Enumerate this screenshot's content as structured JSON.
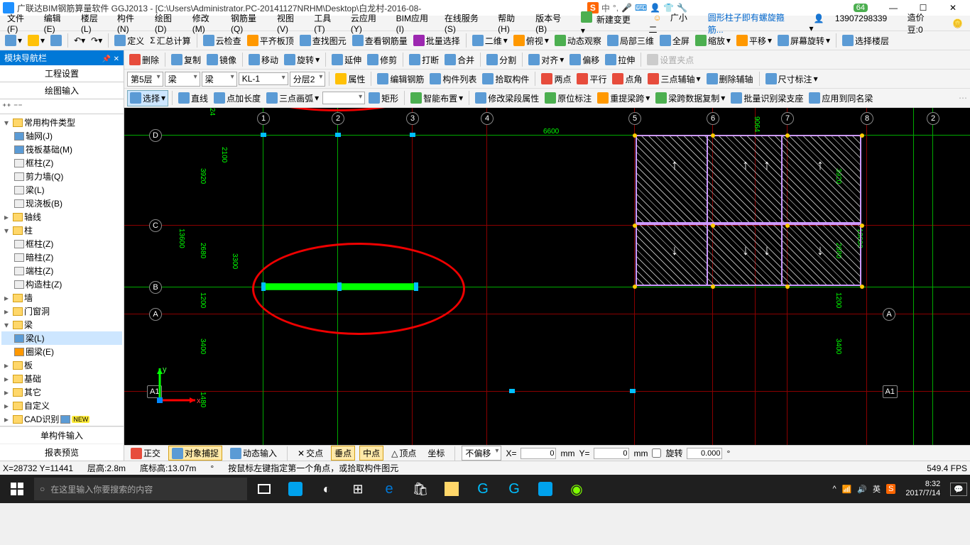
{
  "titlebar": {
    "app_title": "广联达BIM钢筋算量软件 GGJ2013 - [C:\\Users\\Administrator.PC-20141127NRHM\\Desktop\\白龙村-2016-08-",
    "ime_label": "中",
    "badge": "64"
  },
  "menubar": {
    "items": [
      "文件(F)",
      "编辑(E)",
      "楼层(L)",
      "构件(N)",
      "绘图(D)",
      "修改(M)",
      "钢筋量(Q)",
      "视图(V)",
      "工具(T)",
      "云应用(Y)",
      "BIM应用(I)",
      "在线服务(S)",
      "帮助(H)",
      "版本号(B)"
    ],
    "new_change": "新建变更",
    "user_small": "广小二",
    "highlight": "圆形柱子即有螺旋箍筋...",
    "phone": "13907298339",
    "cost_label": "造价豆:0"
  },
  "toolbar1": {
    "items": [
      "定义",
      "汇总计算",
      "云检查",
      "平齐板顶",
      "查找图元",
      "查看钢筋量",
      "批量选择",
      "二维",
      "俯视",
      "动态观察",
      "局部三维",
      "全屏",
      "缩放",
      "平移",
      "屏幕旋转",
      "选择楼层"
    ]
  },
  "toolbar2": {
    "items": [
      "删除",
      "复制",
      "镜像",
      "移动",
      "旋转",
      "延伸",
      "修剪",
      "打断",
      "合并",
      "分割",
      "对齐",
      "偏移",
      "拉伸",
      "设置夹点"
    ]
  },
  "toolbar3": {
    "floor": "第5层",
    "cat1": "梁",
    "cat2": "梁",
    "member": "KL-1",
    "layer": "分层2",
    "items": [
      "属性",
      "编辑钢筋",
      "构件列表",
      "拾取构件",
      "两点",
      "平行",
      "点角",
      "三点辅轴",
      "删除辅轴",
      "尺寸标注"
    ]
  },
  "toolbar4": {
    "select": "选择",
    "items": [
      "直线",
      "点加长度",
      "三点画弧",
      "矩形",
      "智能布置",
      "修改梁段属性",
      "原位标注",
      "重提梁跨",
      "梁跨数据复制",
      "批量识别梁支座",
      "应用到同名梁"
    ]
  },
  "nav": {
    "header": "模块导航栏",
    "tab1": "工程设置",
    "tab2": "绘图输入",
    "tree": {
      "root": "常用构件类型",
      "items1": [
        "轴网(J)",
        "筏板基础(M)",
        "框柱(Z)",
        "剪力墙(Q)",
        "梁(L)",
        "现浇板(B)"
      ],
      "axis": "轴线",
      "column": "柱",
      "col_items": [
        "框柱(Z)",
        "暗柱(Z)",
        "端柱(Z)",
        "构造柱(Z)"
      ],
      "wall": "墙",
      "door": "门窗洞",
      "beam": "梁",
      "beam_items": [
        "梁(L)",
        "圈梁(E)"
      ],
      "slab": "板",
      "found": "基础",
      "other": "其它",
      "custom": "自定义",
      "cad": "CAD识别"
    },
    "bottom1": "单构件输入",
    "bottom2": "报表预览"
  },
  "canvas": {
    "dim_6600": "6600",
    "dims_left": [
      "2100",
      "3920",
      "13600",
      "2680",
      "3300",
      "1200",
      "3400",
      "1480"
    ],
    "dims_right": [
      "3920",
      "13600",
      "2680",
      "1200",
      "3400"
    ],
    "grid_h": [
      "D",
      "C",
      "B",
      "A",
      "A1"
    ],
    "grid_v": [
      "1",
      "2",
      "3",
      "4",
      "5",
      "6",
      "7",
      "8",
      "2"
    ],
    "dim_9064": "9064",
    "dim_24": "24"
  },
  "statusbar": {
    "items": [
      "正交",
      "对象捕捉",
      "动态输入",
      "交点",
      "垂点",
      "中点",
      "顶点",
      "坐标"
    ],
    "offset": "不偏移",
    "x_label": "X=",
    "x_val": "0",
    "mm": "mm",
    "y_label": "Y=",
    "y_val": "0",
    "rotate": "旋转",
    "rot_val": "0.000"
  },
  "infobar": {
    "coord": "X=28732 Y=11441",
    "floor_h": "层高:2.8m",
    "bottom_h": "底标高:13.07m",
    "hint": "按鼠标左键指定第一个角点，或拾取构件图元",
    "fps": "549.4 FPS"
  },
  "taskbar": {
    "search_placeholder": "在这里输入你要搜索的内容",
    "time": "8:32",
    "date": "2017/7/14",
    "lang": "英"
  }
}
